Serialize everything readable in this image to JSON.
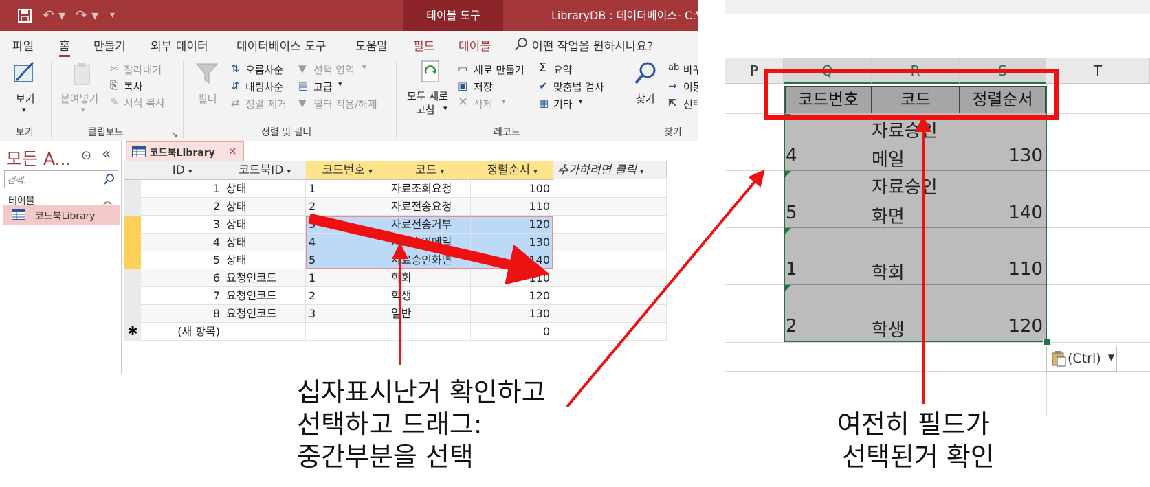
{
  "access": {
    "context_tab": "테이블 도구",
    "window_title": "LibraryDB : 데이터베이스- C:₩U",
    "ribbon_tabs": [
      "파일",
      "홈",
      "만들기",
      "외부 데이터",
      "데이터베이스 도구",
      "도움말",
      "필드",
      "테이블"
    ],
    "tell_me": "어떤 작업을 원하시나요?",
    "ribbon": {
      "view": "보기",
      "paste": "붙여넣기",
      "cut": "잘라내기",
      "copy": "복사",
      "format_painter": "서식 복사",
      "filter": "필터",
      "ascending": "오름차순",
      "descending": "내림차순",
      "remove_sort": "정렬 제거",
      "selection": "선택 영역",
      "advanced": "고급",
      "toggle_filter": "필터 적용/해제",
      "refresh_all_1": "모두 새로",
      "refresh_all_2": "고침",
      "new": "새로 만들기",
      "save": "저장",
      "delete": "삭제",
      "totals": "요약",
      "spelling": "맞춤법 검사",
      "more": "기타",
      "find": "찾기",
      "replace": "바꾸",
      "goto": "이동",
      "select": "선택",
      "groups": [
        "보기",
        "클립보드",
        "정렬 및 필터",
        "레코드",
        "찾기"
      ]
    },
    "nav": {
      "title": "모든 A...",
      "search_placeholder": "검색...",
      "section": "테이블",
      "item": "코드북Library"
    },
    "doc_tab": "코드북Library",
    "columns": [
      "ID",
      "코드북ID",
      "코드번호",
      "코드",
      "정렬순서",
      "추가하려면 클릭"
    ],
    "rows": [
      {
        "id": "1",
        "codebook": "상태",
        "num": "1",
        "code": "자료조회요청",
        "order": "100"
      },
      {
        "id": "2",
        "codebook": "상태",
        "num": "2",
        "code": "자료전송요청",
        "order": "110"
      },
      {
        "id": "3",
        "codebook": "상태",
        "num": "3",
        "code": "자료전송거부",
        "order": "120"
      },
      {
        "id": "4",
        "codebook": "상태",
        "num": "4",
        "code": "자료승인메일",
        "order": "130"
      },
      {
        "id": "5",
        "codebook": "상태",
        "num": "5",
        "code": "자료승인화면",
        "order": "140"
      },
      {
        "id": "6",
        "codebook": "요청인코드",
        "num": "1",
        "code": "학회",
        "order": "110"
      },
      {
        "id": "7",
        "codebook": "요청인코드",
        "num": "2",
        "code": "학생",
        "order": "120"
      },
      {
        "id": "8",
        "codebook": "요청인코드",
        "num": "3",
        "code": "일반",
        "order": "130"
      }
    ],
    "new_row": {
      "marker": "✱",
      "label": "(새 항목)",
      "order": "0"
    }
  },
  "excel": {
    "columns": [
      "P",
      "Q",
      "R",
      "S",
      "T"
    ],
    "header": [
      "코드번호",
      "코드",
      "정렬순서"
    ],
    "rows": [
      {
        "num": "4",
        "code_line1": "자료승인",
        "code_line2": "메일",
        "order": "130"
      },
      {
        "num": "5",
        "code_line1": "자료승인",
        "code_line2": "화면",
        "order": "140"
      },
      {
        "num": "1",
        "code_line1": "",
        "code_line2": "학회",
        "order": "110"
      },
      {
        "num": "2",
        "code_line1": "",
        "code_line2": "학생",
        "order": "120"
      }
    ],
    "paste_options": "(Ctrl)"
  },
  "annotations": {
    "left": [
      "십자표시난거 확인하고",
      "선택하고 드래그:",
      "중간부분을 선택"
    ],
    "right": [
      "여전히 필드가",
      "선택된거 확인"
    ]
  },
  "colors": {
    "access_accent": "#a4373a",
    "excel_accent": "#217346",
    "annotation_red": "#ee1111",
    "selection_blue": "#bcd9f8"
  }
}
